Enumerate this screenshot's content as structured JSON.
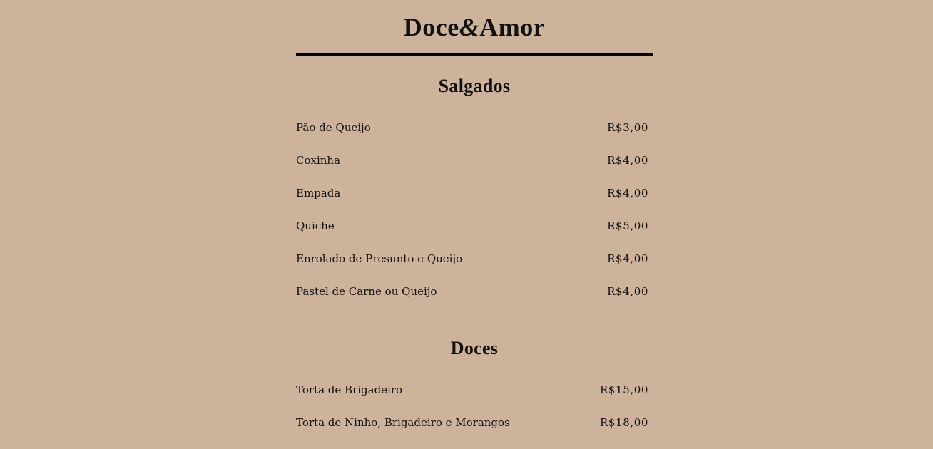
{
  "brand": {
    "part1": "Doce",
    "amp": "&",
    "part2": "Amor"
  },
  "sections": [
    {
      "title": "Salgados",
      "items": [
        {
          "name": "Pão de Queijo",
          "price": "R$3,00"
        },
        {
          "name": "Coxinha",
          "price": "R$4,00"
        },
        {
          "name": "Empada",
          "price": "R$4,00"
        },
        {
          "name": "Quiche",
          "price": "R$5,00"
        },
        {
          "name": "Enrolado de Presunto e Queijo",
          "price": "R$4,00"
        },
        {
          "name": "Pastel de Carne ou Queijo",
          "price": "R$4,00"
        }
      ]
    },
    {
      "title": "Doces",
      "items": [
        {
          "name": "Torta de Brigadeiro",
          "price": "R$15,00"
        },
        {
          "name": "Torta de Ninho, Brigadeiro e Morangos",
          "price": "R$18,00"
        }
      ]
    }
  ]
}
